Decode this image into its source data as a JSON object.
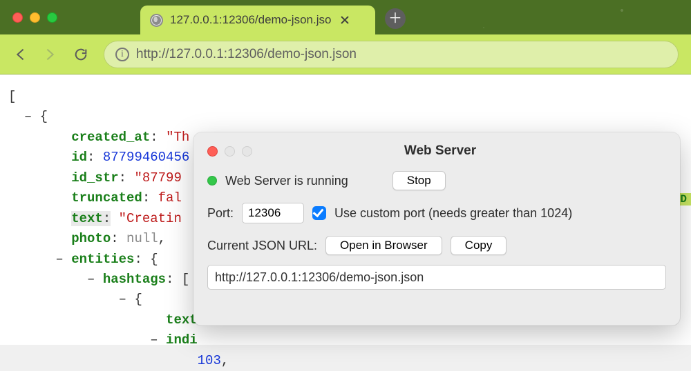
{
  "browser": {
    "tab_title": "127.0.0.1:12306/demo-json.jso",
    "address_url": "http://127.0.0.1:12306/demo-json.json",
    "address_proto_hint": "http://"
  },
  "json": {
    "created_at_key": "created_at",
    "created_at_val": "\"Th",
    "id_key": "id",
    "id_val": "87799460456",
    "id_str_key": "id_str",
    "id_str_val": "\"87799",
    "truncated_key": "truncated",
    "truncated_val": "fal",
    "text_key": "text",
    "text_val": "\"Creatin",
    "photo_key": "photo",
    "photo_val": "null",
    "entities_key": "entities",
    "hashtags_key": "hashtags",
    "text2_key": "text",
    "indi_key": "indi",
    "num103": "103"
  },
  "panel": {
    "title": "Web Server",
    "status_text": "Web Server is running",
    "stop_label": "Stop",
    "port_label": "Port:",
    "port_value": "12306",
    "checkbox_label": "Use custom port (needs greater than 1024)",
    "current_url_label": "Current JSON URL:",
    "open_label": "Open in Browser",
    "copy_label": "Copy",
    "url_value": "http://127.0.0.1:12306/demo-json.json"
  },
  "badge": "D"
}
